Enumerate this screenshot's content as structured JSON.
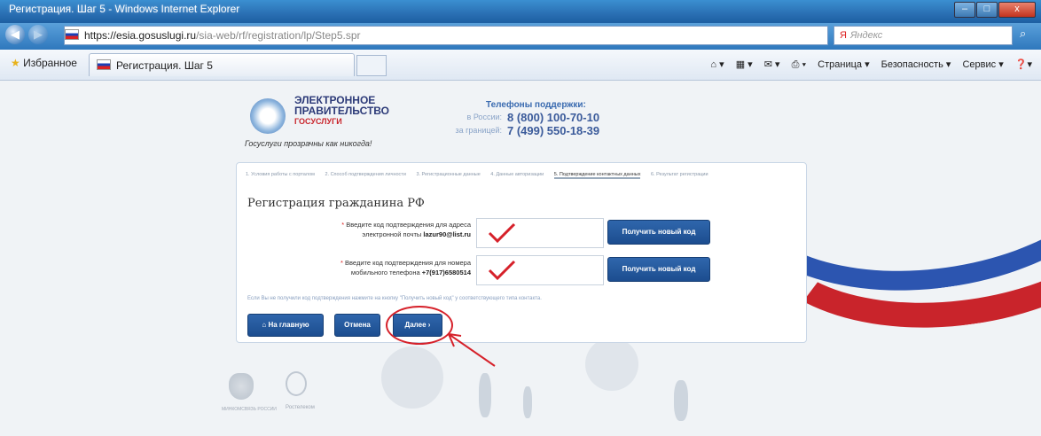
{
  "window": {
    "title": "Регистрация. Шаг 5 - Windows Internet Explorer",
    "minimize": "‒",
    "maximize": "□",
    "close": "x"
  },
  "address_bar": {
    "url_host": "https://esia.gosuslugi.ru",
    "url_path": "/sia-web/rf/registration/lp/Step5.spr",
    "search_placeholder": "Яндекс"
  },
  "favorites_bar": {
    "favorites_label": "Избранное",
    "tab_title": "Регистрация. Шаг 5",
    "commands": [
      "Страница ▾",
      "Безопасность ▾",
      "Сервис ▾"
    ]
  },
  "header": {
    "logo_line1": "ЭЛЕКТРОННОЕ",
    "logo_line2": "ПРАВИТЕЛЬСТВО",
    "logo_line3": "ГОСУСЛУГИ",
    "tagline": "Госуслуги прозрачны как никогда!",
    "support_title": "Телефоны поддержки:",
    "russia_label": "в России:",
    "russia_phone": "8 (800) 100-70-10",
    "abroad_label": "за границей:",
    "abroad_phone": "7 (499) 550-18-39"
  },
  "steps": [
    "1. Условия работы с порталом",
    "2. Способ подтверждения личности",
    "3. Регистрационные данные",
    "4. Данные авторизации",
    "5. Подтверждение контактных данных",
    "6. Результат регистрации"
  ],
  "form": {
    "heading": "Регистрация гражданина РФ",
    "email_label_1": "Введите код подтверждения для адреса",
    "email_label_2": "электронной почты",
    "email_value": "lazur90@list.ru",
    "phone_label_1": "Введите код подтверждения для номера",
    "phone_label_2": "мобильного телефона",
    "phone_value": "+7(917)6580514",
    "new_code_button": "Получить новый код",
    "hint": "Если Вы не получили код подтверждения нажмите на кнопку \"Получить новый код\" у соответствующего типа контакта.",
    "home_button": "На главную",
    "cancel_button": "Отмена",
    "next_button": "Далее"
  },
  "footer": {
    "ministry": "МИНКОМСВЯЗЬ РОССИИ",
    "operator": "Ростелеком"
  }
}
